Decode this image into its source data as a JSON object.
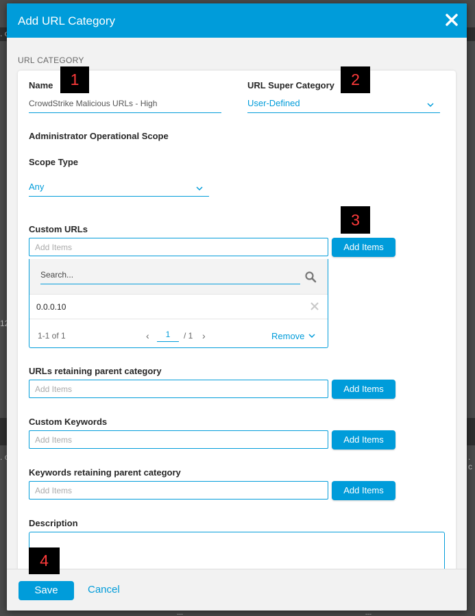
{
  "dialog": {
    "title": "Add URL Category"
  },
  "section": {
    "label": "URL CATEGORY"
  },
  "name_field": {
    "label": "Name",
    "value": "CrowdStrike Malicious URLs - High"
  },
  "super_category": {
    "label": "URL Super Category",
    "value": "User-Defined"
  },
  "admin_scope": {
    "label": "Administrator Operational Scope"
  },
  "scope_type": {
    "label": "Scope Type",
    "value": "Any"
  },
  "custom_urls": {
    "label": "Custom URLs",
    "placeholder": "Add Items",
    "button": "Add Items",
    "search_placeholder": "Search...",
    "items": [
      "0.0.0.10"
    ],
    "range": "1-1 of 1",
    "page": "1",
    "total_pages": "/ 1",
    "remove": "Remove"
  },
  "urls_retaining": {
    "label": "URLs retaining parent category",
    "placeholder": "Add Items",
    "button": "Add Items"
  },
  "custom_keywords": {
    "label": "Custom Keywords",
    "placeholder": "Add Items",
    "button": "Add Items"
  },
  "keywords_retaining": {
    "label": "Keywords retaining parent category",
    "placeholder": "Add Items",
    "button": "Add Items"
  },
  "description": {
    "label": "Description"
  },
  "footer": {
    "save": "Save",
    "cancel": "Cancel"
  },
  "markers": [
    "1",
    "2",
    "3",
    "4"
  ],
  "background": {
    "fragments": [
      ". c",
      "12",
      ". c",
      ". c",
      "---",
      "---"
    ]
  },
  "colors": {
    "accent": "#009cda",
    "marker_bg": "#000000",
    "marker_text": "#ff3b3b"
  }
}
